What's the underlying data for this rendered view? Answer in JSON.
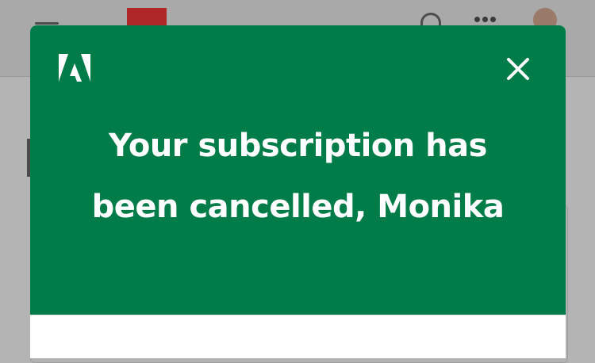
{
  "modal": {
    "title": "Your subscription has been cancelled, Monika"
  },
  "icons": {
    "brand": "adobe-logo-icon",
    "close": "close-icon",
    "menu": "hamburger-menu-icon",
    "notifications": "bell-icon",
    "apps": "app-grid-icon"
  },
  "colors": {
    "hero_green": "#007c48",
    "brand_red": "#b0272a",
    "overlay": "#b4b4b4"
  }
}
